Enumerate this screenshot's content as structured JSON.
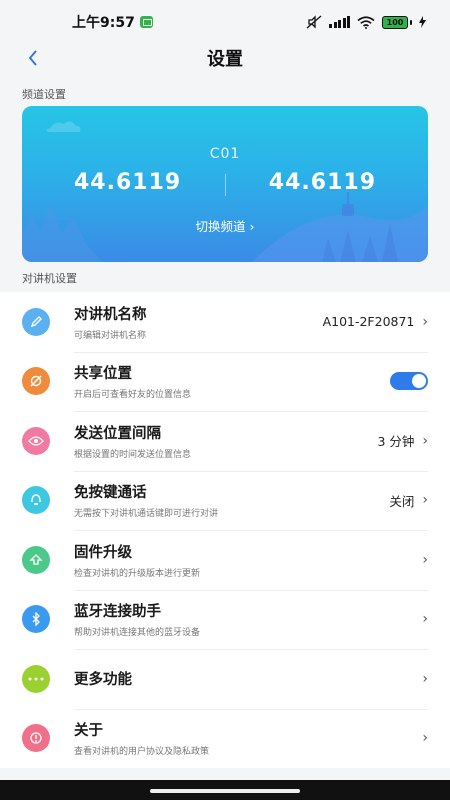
{
  "status_bar": {
    "time": "上午9:57",
    "battery": "100"
  },
  "header": {
    "back_icon": "chevron-left-icon",
    "title": "设置"
  },
  "channel_section": {
    "label": "频道设置",
    "channel_id": "C01",
    "freq_left": "44.6119",
    "freq_right": "44.6119",
    "switch_label": "切换频道",
    "gradient_top": "#26c5e6",
    "gradient_bottom": "#3b8be6"
  },
  "walkie_section": {
    "label": "对讲机设置"
  },
  "settings": [
    {
      "title": "对讲机名称",
      "subtitle": "可编辑对讲机名称",
      "value": "A101-2F20871",
      "icon": "edit-icon",
      "color": "#5ab0f0"
    },
    {
      "title": "共享位置",
      "subtitle": "开启后可查看好友的位置信息",
      "value": "",
      "toggle": true,
      "icon": "location-share-icon",
      "color": "#f08a3c"
    },
    {
      "title": "发送位置间隔",
      "subtitle": "根据设置的时间发送位置信息",
      "value": "3 分钟",
      "icon": "eye-target-icon",
      "color": "#f07aa0"
    },
    {
      "title": "免按键通话",
      "subtitle": "无需按下对讲机通话键即可进行对讲",
      "value": "关闭",
      "icon": "headset-icon",
      "color": "#3ec7e0"
    },
    {
      "title": "固件升级",
      "subtitle": "检查对讲机的升级版本进行更新",
      "value": "",
      "icon": "upgrade-arrow-icon",
      "color": "#4cc98a"
    },
    {
      "title": "蓝牙连接助手",
      "subtitle": "帮助对讲机连接其他的蓝牙设备",
      "value": "",
      "icon": "bluetooth-icon",
      "color": "#3b9af0"
    },
    {
      "title": "更多功能",
      "subtitle": "",
      "value": "",
      "icon": "more-dots-icon",
      "color": "#9ad02f"
    },
    {
      "title": "关于",
      "subtitle": "查看对讲机的用户协议及隐私政策",
      "value": "",
      "icon": "info-icon",
      "color": "#f0708a"
    }
  ]
}
